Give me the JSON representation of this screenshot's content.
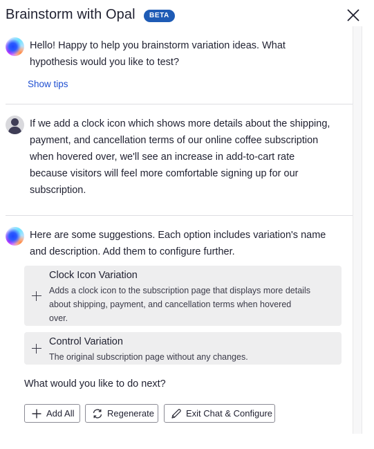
{
  "header": {
    "title": "Brainstorm with Opal",
    "badge": "BETA",
    "close_icon": "close-icon"
  },
  "messages": [
    {
      "sender": "opal",
      "avatar_icon": "opal-orb-icon",
      "text": "Hello! Happy to help you brainstorm variation ideas. What hypothesis would you like to test?",
      "link": "Show tips"
    },
    {
      "sender": "user",
      "avatar_icon": "user-avatar-icon",
      "text": "If we add a clock icon which shows more details about the shipping, payment, and cancellation terms of our online coffee subscription when hovered over, we'll see an increase in add-to-cart rate because visitors will feel more comfortable signing up for our subscription."
    },
    {
      "sender": "opal",
      "avatar_icon": "opal-orb-icon",
      "text": "Here are some suggestions. Each option includes variation's name and description. Add them to configure further.",
      "suggestions": [
        {
          "title": "Clock Icon Variation",
          "description": "Adds a clock icon to the subscription page that displays more details about shipping, payment, and cancellation terms when hovered over."
        },
        {
          "title": "Control Variation",
          "description": "The original subscription page without any changes."
        }
      ],
      "prompt": "What would you like to do next?",
      "actions": [
        {
          "label": "Add All",
          "icon": "plus-icon"
        },
        {
          "label": "Regenerate",
          "icon": "refresh-icon"
        },
        {
          "label": "Exit Chat & Configure",
          "icon": "pencil-icon"
        }
      ]
    }
  ],
  "colors": {
    "badge": "#1e5bb5",
    "link": "#1f4fd1",
    "card_bg": "#eeeeef",
    "text": "#1f2030"
  }
}
